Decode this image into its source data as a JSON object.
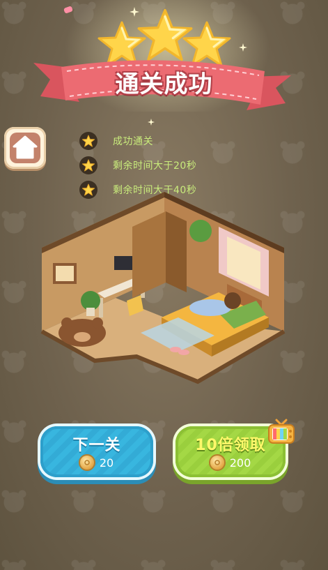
{
  "header": {
    "title": "通关成功",
    "stars_earned": 3
  },
  "home_button": {
    "icon": "house-icon"
  },
  "objectives": [
    {
      "text": "成功通关",
      "achieved": true
    },
    {
      "text": "剩余时间大于20秒",
      "achieved": true
    },
    {
      "text": "剩余时间大于40秒",
      "achieved": true
    }
  ],
  "scene": {
    "description_icon": "room-scene"
  },
  "buttons": {
    "next": {
      "label": "下一关",
      "coins": "20"
    },
    "reward": {
      "label": "10倍领取",
      "coins": "200",
      "icon": "tv-icon"
    }
  },
  "colors": {
    "next_button": "#38b6df",
    "reward_button": "#a4d845",
    "objective_text": "#c9ec7c",
    "ribbon": "#e96a6f"
  }
}
